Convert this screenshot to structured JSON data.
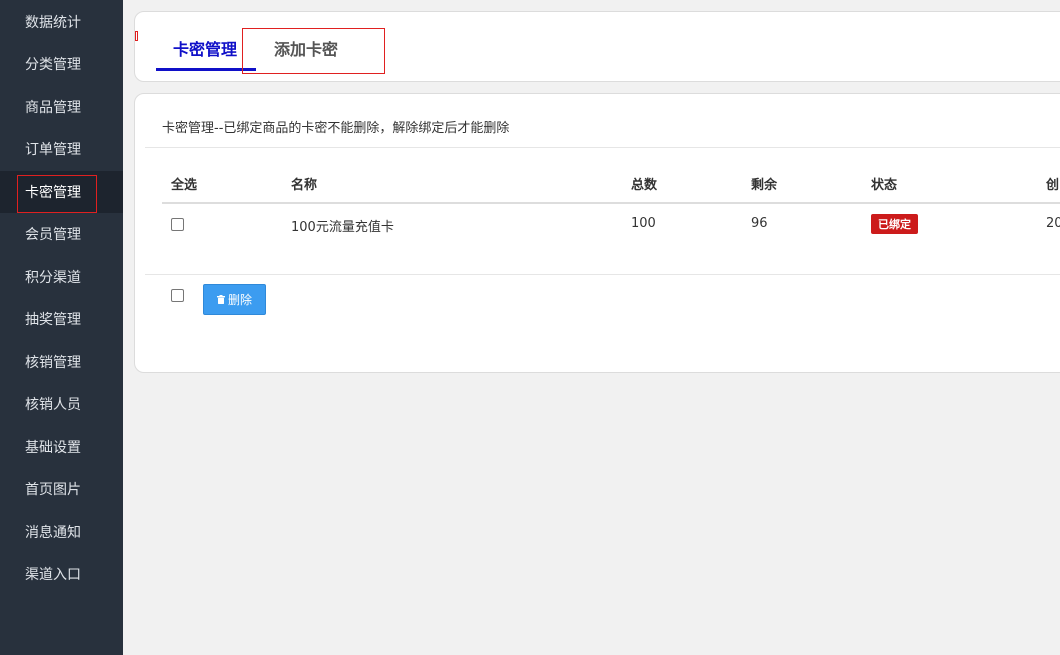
{
  "sidebar": {
    "items": [
      {
        "label": "数据统计"
      },
      {
        "label": "分类管理"
      },
      {
        "label": "商品管理"
      },
      {
        "label": "订单管理"
      },
      {
        "label": "卡密管理",
        "active": true
      },
      {
        "label": "会员管理"
      },
      {
        "label": "积分渠道"
      },
      {
        "label": "抽奖管理"
      },
      {
        "label": "核销管理"
      },
      {
        "label": "核销人员"
      },
      {
        "label": "基础设置"
      },
      {
        "label": "首页图片"
      },
      {
        "label": "消息通知"
      },
      {
        "label": "渠道入口"
      }
    ]
  },
  "tabs": {
    "active_label": "卡密管理",
    "add_label": "添加卡密"
  },
  "notice": "卡密管理--已绑定商品的卡密不能删除，解除绑定后才能删除",
  "table": {
    "headers": {
      "select_all": "全选",
      "name": "名称",
      "total": "总数",
      "remaining": "剩余",
      "status": "状态",
      "created_partial": "创"
    },
    "rows": [
      {
        "name": "100元流量充值卡",
        "total": "100",
        "remaining": "96",
        "status": "已绑定",
        "created_partial": "20"
      }
    ]
  },
  "actions": {
    "delete_label": "删除",
    "delete_icon": "trash-icon"
  },
  "colors": {
    "sidebar_bg": "#28313d",
    "accent": "#1010c8",
    "badge": "#cc1b1b",
    "button": "#3c9cf0"
  }
}
